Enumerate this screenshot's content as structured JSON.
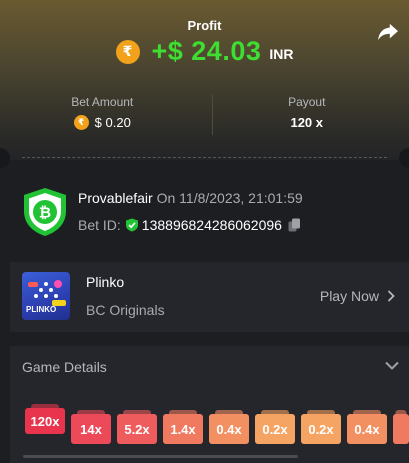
{
  "header": {
    "profit_label": "Profit",
    "profit_amount": "+$ 24.03",
    "currency": "INR",
    "coin_symbol": "₹"
  },
  "stats": {
    "bet_amount_label": "Bet Amount",
    "bet_amount_value": "$ 0.20",
    "payout_label": "Payout",
    "payout_value": "120 x"
  },
  "provably_fair": {
    "name": "Provablefair",
    "date_text": "On 11/8/2023, 21:01:59",
    "bet_id_label": "Bet ID:",
    "bet_id": "138896824286062096"
  },
  "game": {
    "name": "Plinko",
    "category": "BC Originals",
    "thumb_text": "PLINKO",
    "play_now_label": "Play Now"
  },
  "details": {
    "title": "Game Details",
    "buckets": [
      "120x",
      "14x",
      "5.2x",
      "1.4x",
      "0.4x",
      "0.2x",
      "0.2x",
      "0.4x",
      ""
    ]
  },
  "colors": {
    "profit_green": "#3dde31",
    "coin_orange": "#f1a11a",
    "shield_green": "#21c335",
    "bucket_colors": [
      "#e8344c",
      "#ec4a59",
      "#ee5c5d",
      "#f07a5f",
      "#f39062",
      "#f6a463",
      "#f6a463",
      "#f39062",
      "#f07a5f"
    ]
  }
}
